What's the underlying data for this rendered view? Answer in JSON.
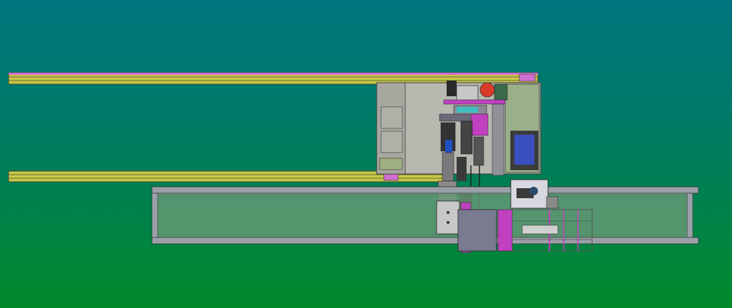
{
  "scene": {
    "background_top": "#00747e",
    "background_bottom": "#008a2a",
    "rail_color": "#c8c84a",
    "rail_edge": "#5a5a2a",
    "frame_color": "#9aa0a8",
    "panel_fill": "#6a9a78",
    "magenta": "#c040c0",
    "screen_color": "#3a50c0"
  }
}
